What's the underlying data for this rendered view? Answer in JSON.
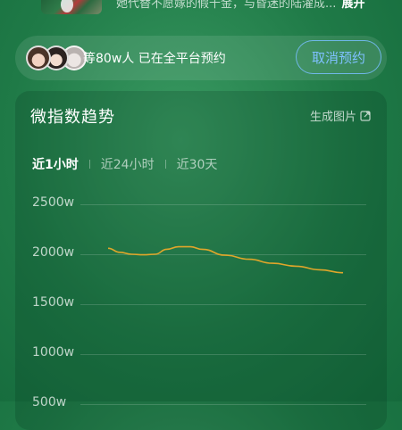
{
  "show": {
    "synopsis": "她代替不愿嫁的假千金，与昏迷的陆濯成...",
    "expand_label": "展开"
  },
  "reservation": {
    "text": "等80w人 已在全平台预约",
    "cancel_label": "取消预约"
  },
  "trend_card": {
    "title": "微指数趋势",
    "generate_image_label": "生成图片",
    "tabs": [
      {
        "label": "近1小时",
        "active": true
      },
      {
        "label": "近24小时",
        "active": false
      },
      {
        "label": "近30天",
        "active": false
      }
    ]
  },
  "chart_data": {
    "type": "line",
    "title": "",
    "xlabel": "",
    "ylabel": "",
    "ytick_labels": [
      "2500w",
      "2000w",
      "1500w",
      "1000w",
      "500w"
    ],
    "ylim": [
      500,
      2500
    ],
    "grid": true,
    "series": [
      {
        "color": "#e0a62a",
        "x": [
          0,
          0.05,
          0.1,
          0.15,
          0.2,
          0.25,
          0.3,
          0.35,
          0.4,
          0.5,
          0.6,
          0.7,
          0.8,
          0.9,
          1.0
        ],
        "values": [
          2060,
          2020,
          2000,
          1995,
          2000,
          2050,
          2075,
          2075,
          2050,
          1990,
          1950,
          1910,
          1880,
          1845,
          1815
        ]
      }
    ]
  }
}
